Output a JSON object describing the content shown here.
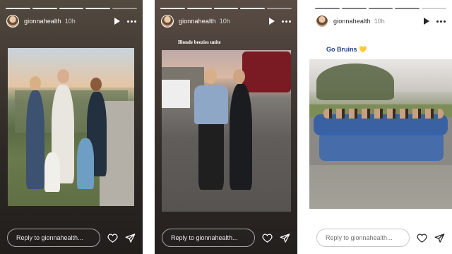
{
  "stories": [
    {
      "username": "gionnahealth",
      "time": "10h",
      "caption": "",
      "reply_placeholder": "Reply to gionnahealth...",
      "progress_done": 4,
      "progress_total": 5
    },
    {
      "username": "gionnahealth",
      "time": "10h",
      "caption": "Blonde beezies unite",
      "reply_placeholder": "Reply to gionnahealth...",
      "progress_done": 4,
      "progress_total": 5
    },
    {
      "username": "gionnahealth",
      "time": "10h",
      "caption": "Go Bruins 💛",
      "reply_placeholder": "Reply to gionnahealth...",
      "progress_done": 4,
      "progress_total": 5
    }
  ],
  "icons": {
    "play": "play-icon",
    "more": "more-icon",
    "heart": "heart-icon",
    "send": "send-icon"
  },
  "colors": {
    "caption_blue": "#1f3e8a",
    "story_dark": "#2f2a26"
  }
}
